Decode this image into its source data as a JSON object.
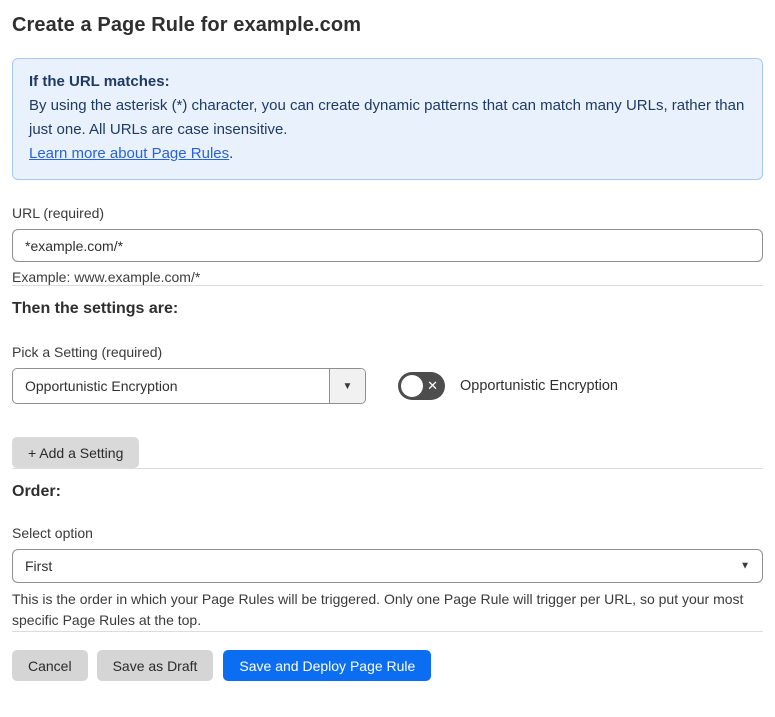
{
  "page": {
    "title": "Create a Page Rule for example.com"
  },
  "info_box": {
    "heading": "If the URL matches:",
    "body": "By using the asterisk (*) character, you can create dynamic patterns that can match many URLs, rather than just one. All URLs are case insensitive.",
    "link": "Learn more about Page Rules",
    "link_suffix": "."
  },
  "url_section": {
    "label": "URL (required)",
    "value": "*example.com/*",
    "helper": "Example: www.example.com/*"
  },
  "settings_section": {
    "heading": "Then the settings are:",
    "picker_label": "Pick a Setting (required)",
    "picker_value": "Opportunistic Encryption",
    "toggle_state": "off",
    "toggle_label": "Opportunistic Encryption",
    "add_button": "+ Add a Setting"
  },
  "order_section": {
    "heading": "Order:",
    "label": "Select option",
    "value": "First",
    "helper": "This is the order in which your Page Rules will be triggered. Only one Page Rule will trigger per URL, so put your most specific Page Rules at the top."
  },
  "footer": {
    "cancel": "Cancel",
    "save_draft": "Save as Draft",
    "save_deploy": "Save and Deploy Page Rule"
  },
  "icons": {
    "dropdown_arrow": "▼",
    "select_chevron": "▼",
    "toggle_off_x": "✕"
  },
  "colors": {
    "accent_blue": "#0b6ef2",
    "info_bg": "#e9f2fc",
    "info_border": "#a9c8ed",
    "info_text": "#1e3a66",
    "link_blue": "#2a62d9",
    "toggle_off_bg": "#4d4d4d",
    "button_gray": "#d5d5d5",
    "divider": "#dcdcdc"
  }
}
